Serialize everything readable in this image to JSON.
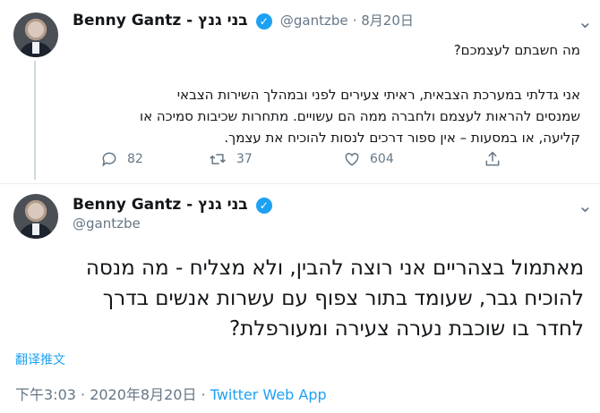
{
  "tweet1": {
    "author_name": "Benny Gantz - בני גנץ",
    "handle": "@gantzbe",
    "date": "· 8月20日",
    "lines": [
      "מה חשבתם לעצמכם?",
      "אני גדלתי במערכת הצבאית, ראיתי צעירים לפני ובמהלך השירות הצבאי",
      "שמנסים להראות לעצמם ולחברה ממה הם עשויים. מתחרות שכיבות סמיכה או",
      "קליעה, או במסעות – אין ספור דרכים לנסות להוכיח את עצמך."
    ],
    "replies": "82",
    "retweets": "37",
    "likes": "604"
  },
  "tweet2": {
    "author_name": "Benny Gantz - בני גנץ",
    "handle": "@gantzbe",
    "lines": [
      "מאתמול בצהריים אני רוצה להבין, ולא מצליח - מה מנסה",
      "להוכיח גבר, שעומד בתור צפוף עם עשרות אנשים בדרך",
      "לחדר בו שוכבת נערה צעירה ומעורפלת?"
    ],
    "translate_label": "翻译推文",
    "timestamp": "下午3:03 · 2020年8月20日 · ",
    "app": "Twitter Web App"
  },
  "icons": {
    "verified": "verified-badge-icon",
    "more": "chevron-down-icon",
    "reply": "reply-icon",
    "retweet": "retweet-icon",
    "like": "heart-icon",
    "share": "share-icon"
  },
  "colors": {
    "accent": "#1da1f2",
    "secondary_text": "#657786",
    "divider": "#e6ecf0"
  }
}
